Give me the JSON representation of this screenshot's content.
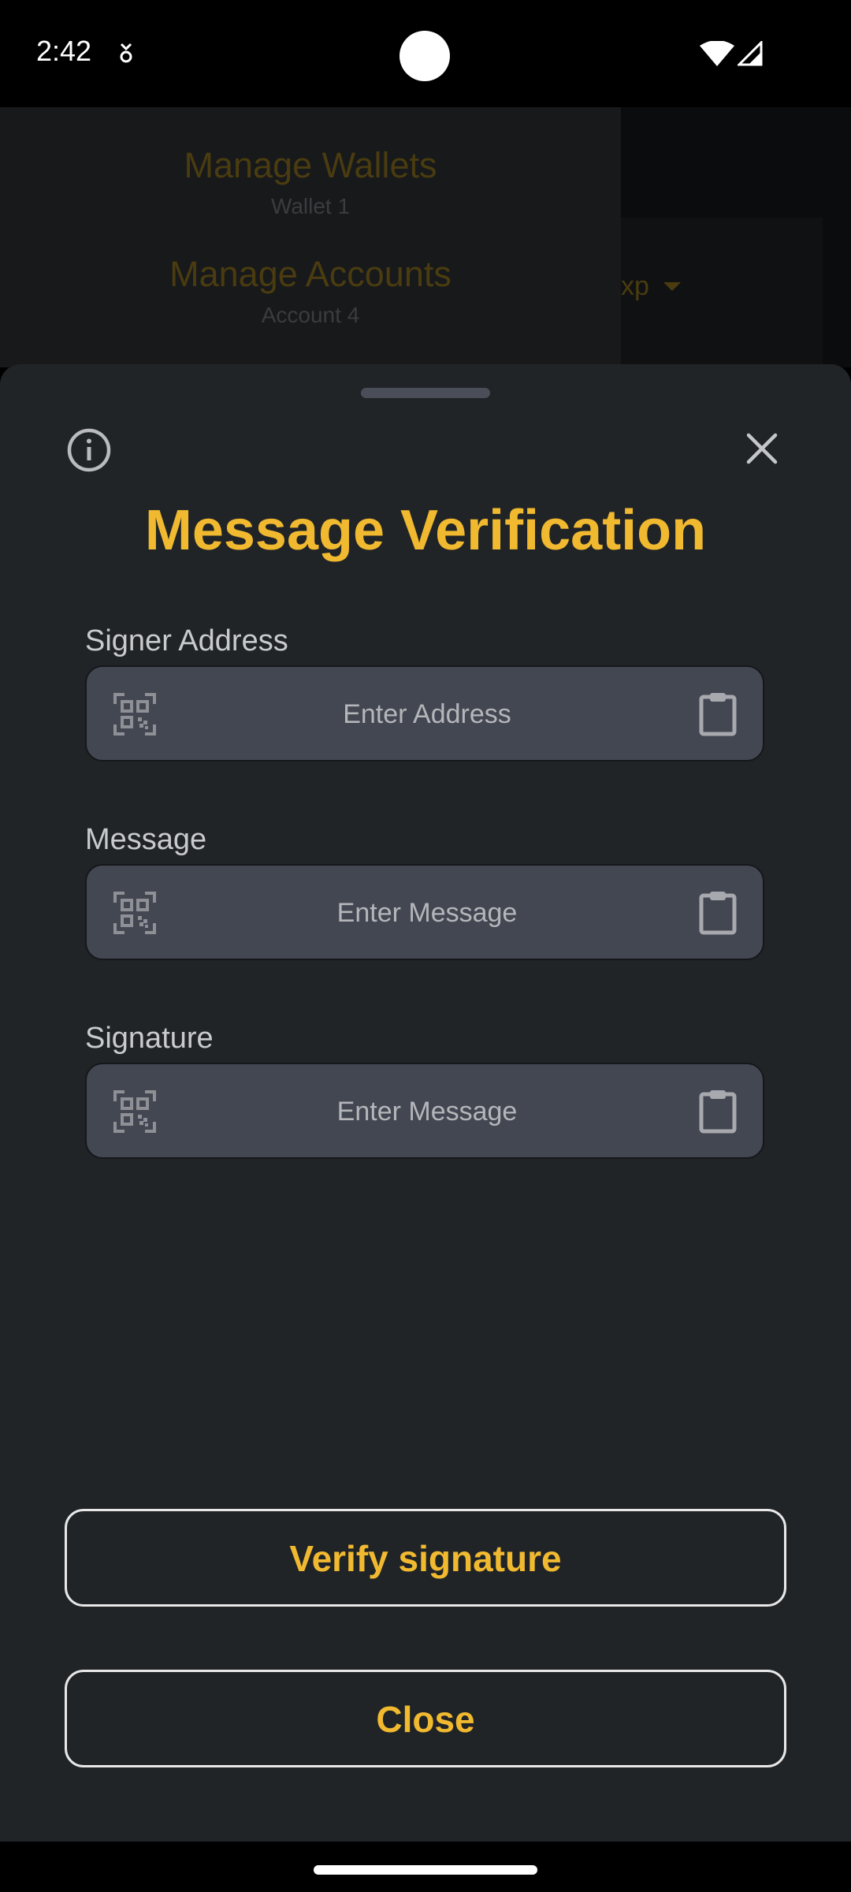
{
  "status_bar": {
    "time": "2:42"
  },
  "background": {
    "drawer": {
      "wallets_title": "Manage Wallets",
      "wallets_sub": "Wallet 1",
      "accounts_title": "Manage Accounts",
      "accounts_sub": "Account 4"
    },
    "card_text": "xp"
  },
  "sheet": {
    "title": "Message Verification",
    "fields": [
      {
        "label": "Signer Address",
        "placeholder": "Enter Address",
        "value": ""
      },
      {
        "label": "Message",
        "placeholder": "Enter Message",
        "value": ""
      },
      {
        "label": "Signature",
        "placeholder": "Enter Message",
        "value": ""
      }
    ],
    "verify_label": "Verify signature",
    "close_label": "Close"
  },
  "colors": {
    "accent": "#f0b92f",
    "sheet_bg": "#212427",
    "field_bg": "#434752"
  },
  "icons": {
    "info": "info-circle-icon",
    "close": "close-icon",
    "qr": "qr-code-scan-icon",
    "paste": "clipboard-icon"
  }
}
